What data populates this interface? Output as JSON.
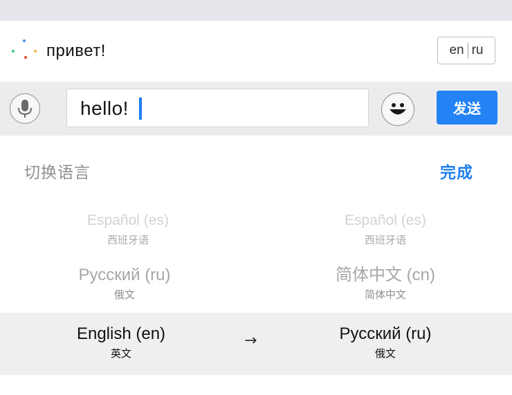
{
  "header": {
    "reply_text": "привет!",
    "lang_toggle": {
      "left": "en",
      "right": "ru"
    }
  },
  "input": {
    "value": "hello!",
    "send_label": "发送"
  },
  "language_panel": {
    "title": "切换语言",
    "done_label": "完成",
    "rows": [
      {
        "left": {
          "name": "Español (es)",
          "native": "西班牙语"
        },
        "right": {
          "name": "Español (es)",
          "native": "西班牙语"
        }
      },
      {
        "left": {
          "name": "Русский (ru)",
          "native": "俄文"
        },
        "right": {
          "name": "简体中文 (cn)",
          "native": "简体中文"
        }
      },
      {
        "left": {
          "name": "English (en)",
          "native": "英文"
        },
        "arrow": "→",
        "right": {
          "name": "Русский (ru)",
          "native": "俄文"
        }
      }
    ]
  },
  "colors": {
    "accent": "#2383f5",
    "input_bar_bg": "#ececef",
    "selected_row_bg": "#efeff1"
  }
}
